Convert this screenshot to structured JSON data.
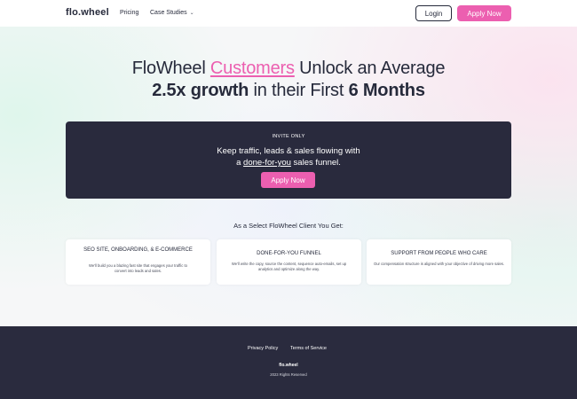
{
  "header": {
    "logo": "flo.wheel",
    "nav": {
      "pricing": "Pricing",
      "case_studies": "Case Studies"
    },
    "login": "Login",
    "apply": "Apply Now"
  },
  "hero": {
    "line1_pre": "FloWheel ",
    "line1_accent": "Customers",
    "line1_post": " Unlock an Average",
    "line2_bold1": "2.5x growth",
    "line2_mid": " in their First ",
    "line2_bold2": "6 Months"
  },
  "invite": {
    "label": "INVITE ONLY",
    "text1": "Keep traffic, leads & sales flowing with",
    "text2_pre": "a ",
    "text2_link": "done-for-you",
    "text2_post": " sales funnel.",
    "button": "Apply Now"
  },
  "features": {
    "heading": "As a Select FloWheel Client You Get:",
    "items": [
      {
        "title": "SEO SITE, ONBOARDING, & E-COMMERCE",
        "desc": "We'll build you a blazing fast site that engages your traffic to convert into leads and sales."
      },
      {
        "title": "DONE-FOR-YOU FUNNEL",
        "desc": "We'll write the copy, source the content, sequence auto-emails, set up analytics and optimize along the way."
      },
      {
        "title": "SUPPORT FROM PEOPLE WHO CARE",
        "desc": "Our compensation structure is aligned with your objective of driving more sales."
      }
    ]
  },
  "footer": {
    "privacy": "Privacy Policy",
    "terms": "Terms of Service",
    "logo": "flo.wheel",
    "copyright": "2023 Rights Reserved"
  },
  "colors": {
    "accent": "#ec5fb0",
    "dark": "#292a3d",
    "text": "#262a3b"
  }
}
